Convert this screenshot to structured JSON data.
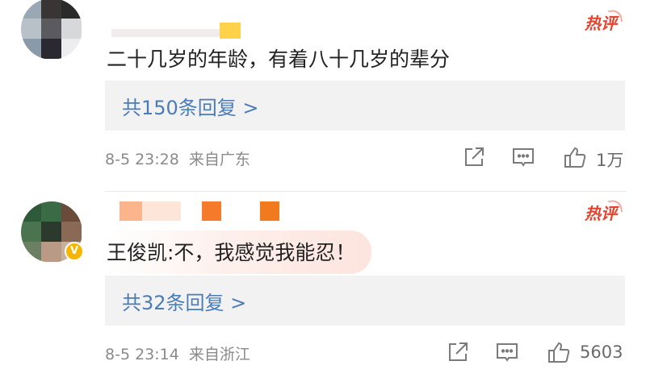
{
  "comments": [
    {
      "text": "二十几岁的年龄，有着八十几岁的辈分",
      "reply_label": "共150条回复 >",
      "date": "8-5 23:28",
      "source": "来自广东",
      "likes": "1万",
      "hot_badge": "热评",
      "verified": false
    },
    {
      "text": "王俊凯:不，我感觉我能忍！",
      "reply_label": "共32条回复 >",
      "date": "8-5 23:14",
      "source": "来自浙江",
      "likes": "5603",
      "hot_badge": "热评",
      "verified": true,
      "verified_mark": "V"
    }
  ],
  "icons": {
    "share": "share-icon",
    "comment": "comment-icon",
    "like": "like-icon"
  },
  "colors": {
    "reply_link": "#4a7cb6",
    "hot_badge": "#e8412c",
    "meta": "#8a8a8a",
    "reply_box_bg": "#f2f2f2",
    "verified_badge": "#f7b500"
  }
}
